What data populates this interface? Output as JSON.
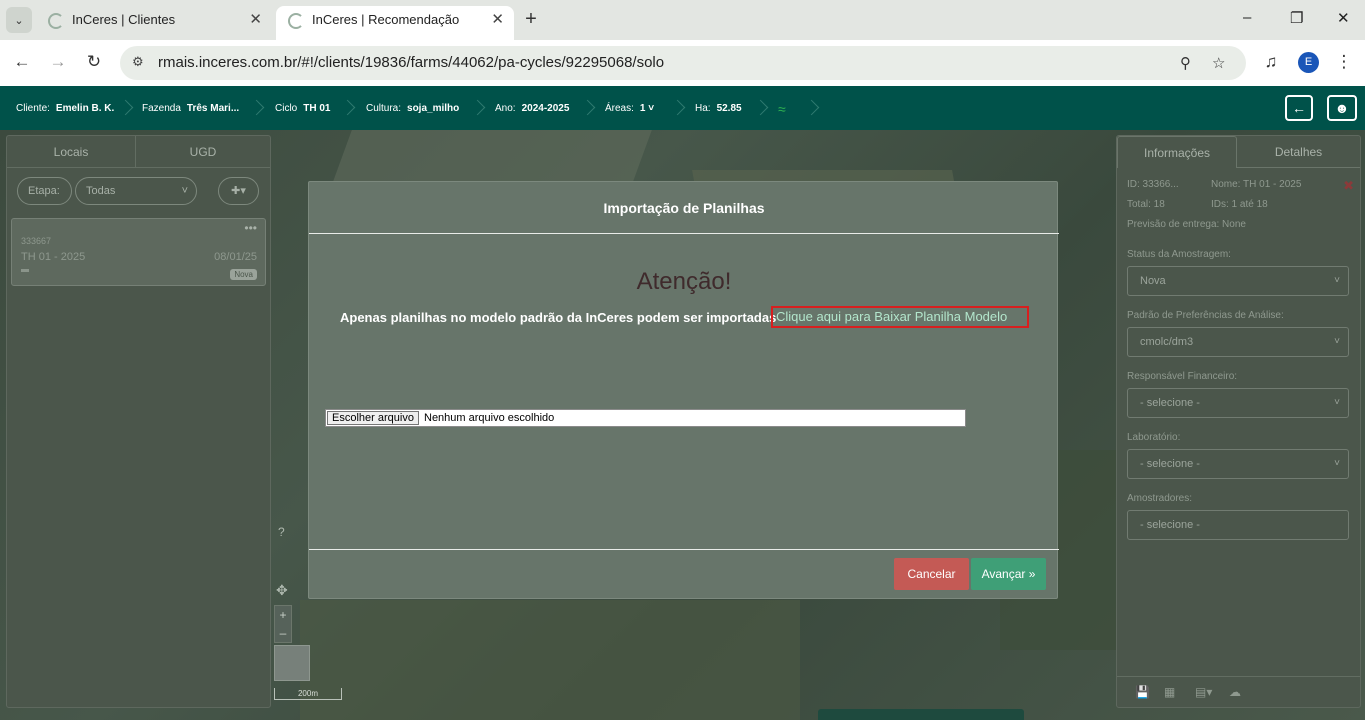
{
  "browser": {
    "tabs": [
      {
        "title": "InCeres | Clientes"
      },
      {
        "title": "InCeres | Recomendação"
      }
    ],
    "url": "rmais.inceres.com.br/#!/clients/19836/farms/44062/pa-cycles/92295068/solo",
    "profile_initial": "E"
  },
  "appbar": {
    "cliente": {
      "key": "Cliente:",
      "value": "Emelin B. K."
    },
    "fazenda": {
      "key": "Fazenda",
      "value": "Três Mari..."
    },
    "ciclo": {
      "key": "Ciclo",
      "value": "TH 01"
    },
    "cultura": {
      "key": "Cultura:",
      "value": "soja_milho"
    },
    "ano": {
      "key": "Ano:",
      "value": "2024-2025"
    },
    "areas": {
      "key": "Áreas:",
      "value": "1"
    },
    "ha": {
      "key": "Ha:",
      "value": "52.85"
    }
  },
  "left_panel": {
    "tabs": [
      "Locais",
      "UGD"
    ],
    "etapa_label": "Etapa:",
    "etapa_value": "Todas",
    "card": {
      "id": "333667",
      "name": "TH 01 - 2025",
      "date": "08/01/25",
      "badge": "Nova"
    }
  },
  "right_panel": {
    "tabs": [
      "Informações",
      "Detalhes"
    ],
    "id_text": "ID: 33366...",
    "nome_text": "Nome: TH 01 - 2025",
    "total_text": "Total: 18",
    "ids_text": "IDs: 1 até 18",
    "previsao_text": "Previsão de entrega: None",
    "status_label": "Status da Amostragem:",
    "status_value": "Nova",
    "padrao_label": "Padrão de Preferências de Análise:",
    "padrao_value": "cmolc/dm3",
    "financeiro_label": "Responsável Financeiro:",
    "financeiro_value": "- selecione -",
    "laboratorio_label": "Laboratório:",
    "laboratorio_value": "- selecione -",
    "amostradores_label": "Amostradores:",
    "amostradores_value": "- selecione -"
  },
  "map": {
    "scale": "200m"
  },
  "modal": {
    "title": "Importação de Planilhas",
    "attention": "Atenção!",
    "message": "Apenas planilhas no modelo padrão da InCeres podem ser importadas",
    "download_link": "Clique aqui para Baixar Planilha Modelo",
    "file_button": "Escolher arquivo",
    "file_status": "Nenhum arquivo escolhido",
    "cancel": "Cancelar",
    "next": "Avançar"
  },
  "colors": {
    "appbar": "#00524a",
    "cancel": "#c45a55",
    "next": "#3f9f77",
    "highlight": "#d81f1f"
  }
}
